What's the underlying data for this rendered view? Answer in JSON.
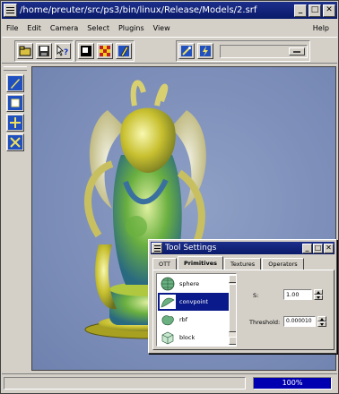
{
  "window": {
    "title": "/home/preuter/src/ps3/bin/linux/Release/Models/2.srf",
    "minimize_icon": "minimize-icon",
    "maximize_icon": "maximize-icon",
    "close_icon": "close-icon"
  },
  "menubar": {
    "items": [
      "File",
      "Edit",
      "Camera",
      "Select",
      "Plugins",
      "View"
    ],
    "help": "Help"
  },
  "toolbar": {
    "icons": [
      "open-folder-icon",
      "save-disk-icon",
      "help-pointer-icon",
      "square-select-icon",
      "checker-icon",
      "pen-tool-icon",
      "wand-icon",
      "lightning-icon"
    ],
    "combo_value": ""
  },
  "left_toolbar": {
    "icons": [
      "pencil-icon",
      "rectangle-icon",
      "move-arrows-icon",
      "delete-x-icon"
    ]
  },
  "viewport": {
    "model_name": "2.srf"
  },
  "status": {
    "message": "",
    "progress_percent": 100,
    "progress_label": "100%"
  },
  "tool_settings": {
    "title": "Tool Settings",
    "tabs": [
      "OTT",
      "Primitives",
      "Textures",
      "Operators"
    ],
    "active_tab": "Primitives",
    "primitives": [
      {
        "label": "sphere",
        "icon": "sphere-icon",
        "selected": false
      },
      {
        "label": "convpoint",
        "icon": "convpoint-icon",
        "selected": true
      },
      {
        "label": "rbf",
        "icon": "rbf-icon",
        "selected": false
      },
      {
        "label": "block",
        "icon": "block-icon",
        "selected": false
      }
    ],
    "params": {
      "s_label": "S:",
      "s_value": "1.00",
      "threshold_label": "Threshold:",
      "threshold_value": "0.000010"
    }
  },
  "colors": {
    "titlebar": "#0a1a6a",
    "viewport_bg": "#7b8db8",
    "selection": "#0a1a8a",
    "progress_fill": "#0000b0"
  }
}
